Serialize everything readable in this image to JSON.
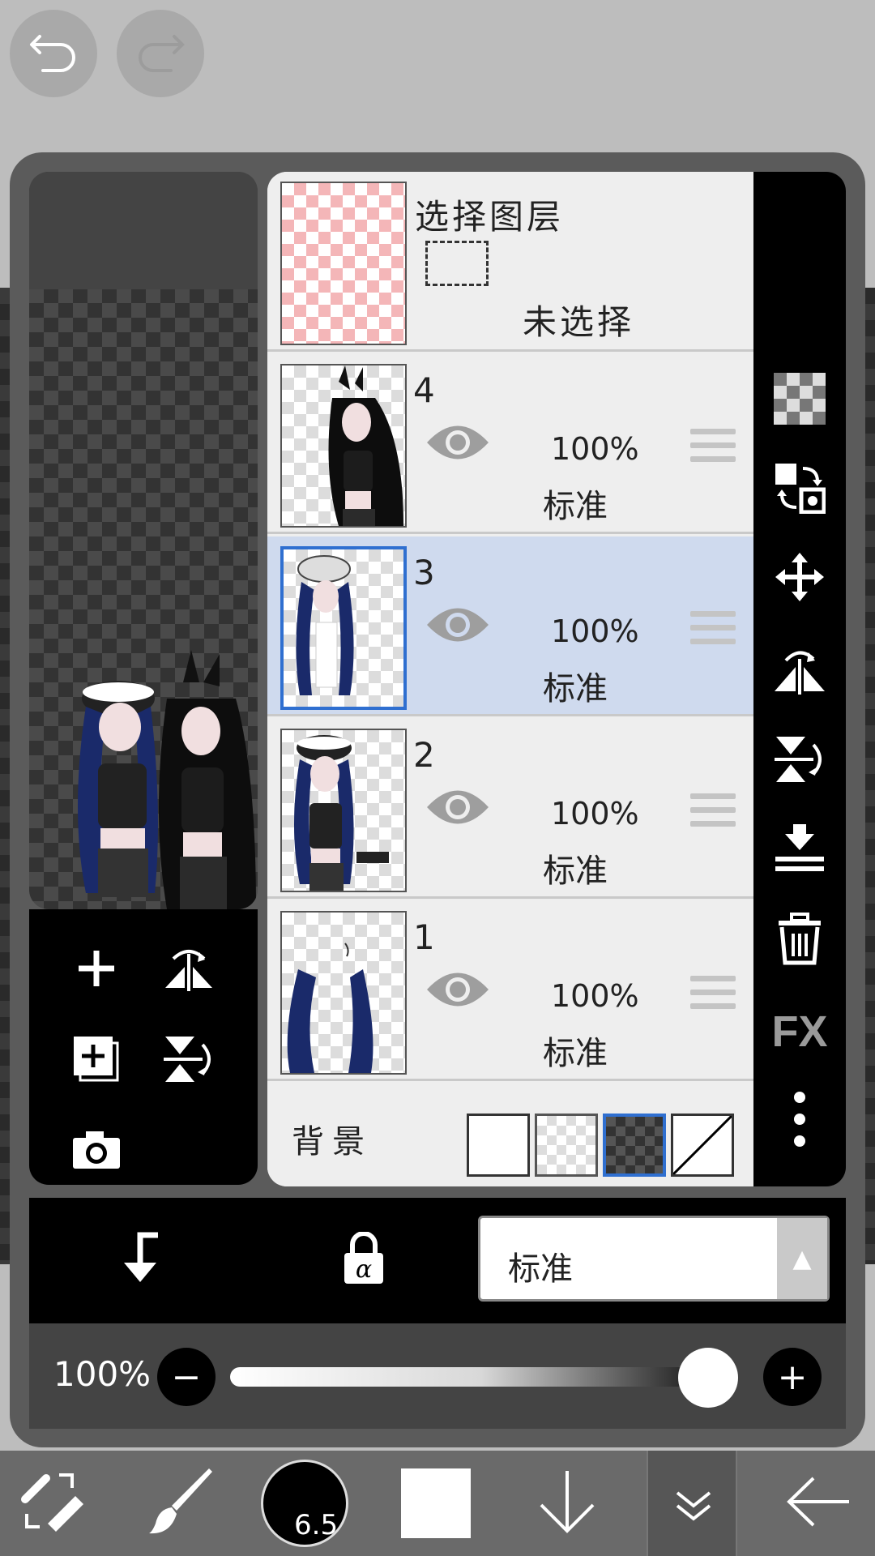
{
  "selection_layer": {
    "title": "选择图层",
    "status": "未选择"
  },
  "layers": [
    {
      "number": "4",
      "opacity": "100%",
      "blend": "标准",
      "selected": false
    },
    {
      "number": "3",
      "opacity": "100%",
      "blend": "标准",
      "selected": true
    },
    {
      "number": "2",
      "opacity": "100%",
      "blend": "标准",
      "selected": false
    },
    {
      "number": "1",
      "opacity": "100%",
      "blend": "标准",
      "selected": false
    }
  ],
  "background": {
    "label": "背景"
  },
  "right_toolbar": {
    "fx_label": "FX"
  },
  "controls": {
    "blend_mode": "标准"
  },
  "opacity_slider": {
    "label": "100%",
    "value_percent": 100
  },
  "bottom_bar": {
    "brush_size": "6.5"
  },
  "colors": {
    "accent": "#2f6fd0",
    "active_row": "#cfdaee",
    "selection_thumb": "#f4b6b8"
  }
}
